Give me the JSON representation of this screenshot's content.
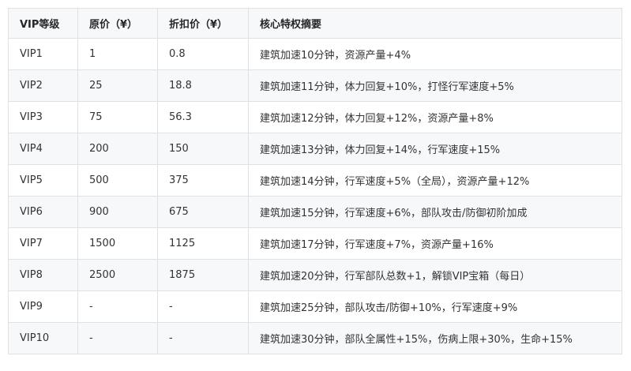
{
  "table": {
    "headers": [
      "VIP等级",
      "原价（¥）",
      "折扣价（¥）",
      "核心特权摘要"
    ],
    "rows": [
      [
        "VIP1",
        "1",
        "0.8",
        "建筑加速10分钟，资源产量+4%"
      ],
      [
        "VIP2",
        "25",
        "18.8",
        "建筑加速11分钟，体力回复+10%，打怪行军速度+5%"
      ],
      [
        "VIP3",
        "75",
        "56.3",
        "建筑加速12分钟，体力回复+12%，资源产量+8%"
      ],
      [
        "VIP4",
        "200",
        "150",
        "建筑加速13分钟，体力回复+14%，行军速度+15%"
      ],
      [
        "VIP5",
        "500",
        "375",
        "建筑加速14分钟，行军速度+5%（全局），资源产量+12%"
      ],
      [
        "VIP6",
        "900",
        "675",
        "建筑加速15分钟，行军速度+6%，部队攻击/防御初阶加成"
      ],
      [
        "VIP7",
        "1500",
        "1125",
        "建筑加速17分钟，行军速度+7%，资源产量+16%"
      ],
      [
        "VIP8",
        "2500",
        "1875",
        "建筑加速20分钟，行军部队总数+1，解锁VIP宝箱（每日）"
      ],
      [
        "VIP9",
        "-",
        "-",
        "建筑加速25分钟，部队攻击/防御+10%，行军速度+9%"
      ],
      [
        "VIP10",
        "-",
        "-",
        "建筑加速30分钟，部队全属性+15%，伤病上限+30%，生命+15%"
      ]
    ]
  }
}
